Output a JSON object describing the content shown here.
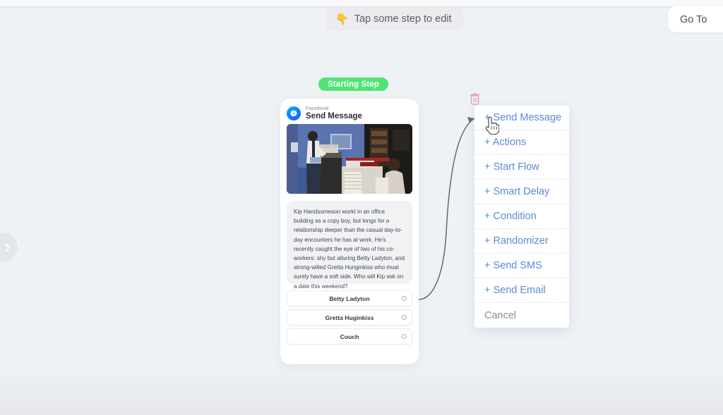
{
  "topbar": {
    "tooltip_emoji": "👇",
    "tooltip_text": "Tap some step to edit",
    "goto_label": "Go To"
  },
  "canvas": {
    "expander_icon": "chevron-right-icon",
    "starting_badge": "Starting Step"
  },
  "message_card": {
    "channel_icon": "messenger-icon",
    "channel": "Facebook",
    "step_title": "Send Message",
    "image_alt": "office-scene-image",
    "body_text": "Kip Handsomeson workt in an office building as a copy boy, but longs for a relationship deeper than the casual day-to-day encounters he has at work. He's recently caught the eye of two of his co-workers: shy but alluring Betty Ladyton, and strong-willed Gretta Hunginkiss who must surely have a soft side. Who will Kip ask on a date this weekend?",
    "choices": [
      {
        "label": "Betty Ladyton"
      },
      {
        "label": "Gretta Huginkiss"
      },
      {
        "label": "Couch"
      }
    ]
  },
  "action_menu": {
    "delete_icon": "trash-icon",
    "cursor_icon": "pointing-hand-cursor",
    "items": [
      {
        "label": "+ Send Message"
      },
      {
        "label": "+ Actions"
      },
      {
        "label": "+ Start Flow"
      },
      {
        "label": "+ Smart Delay"
      },
      {
        "label": "+ Condition"
      },
      {
        "label": "+ Randomizer"
      },
      {
        "label": "+ Send SMS"
      },
      {
        "label": "+ Send Email"
      }
    ],
    "cancel_label": "Cancel"
  },
  "colors": {
    "canvas_bg": "#eef2f5",
    "accent_blue": "#5b8ad6",
    "badge_green": "#4ee575",
    "trash_red": "#e8a5b8"
  }
}
